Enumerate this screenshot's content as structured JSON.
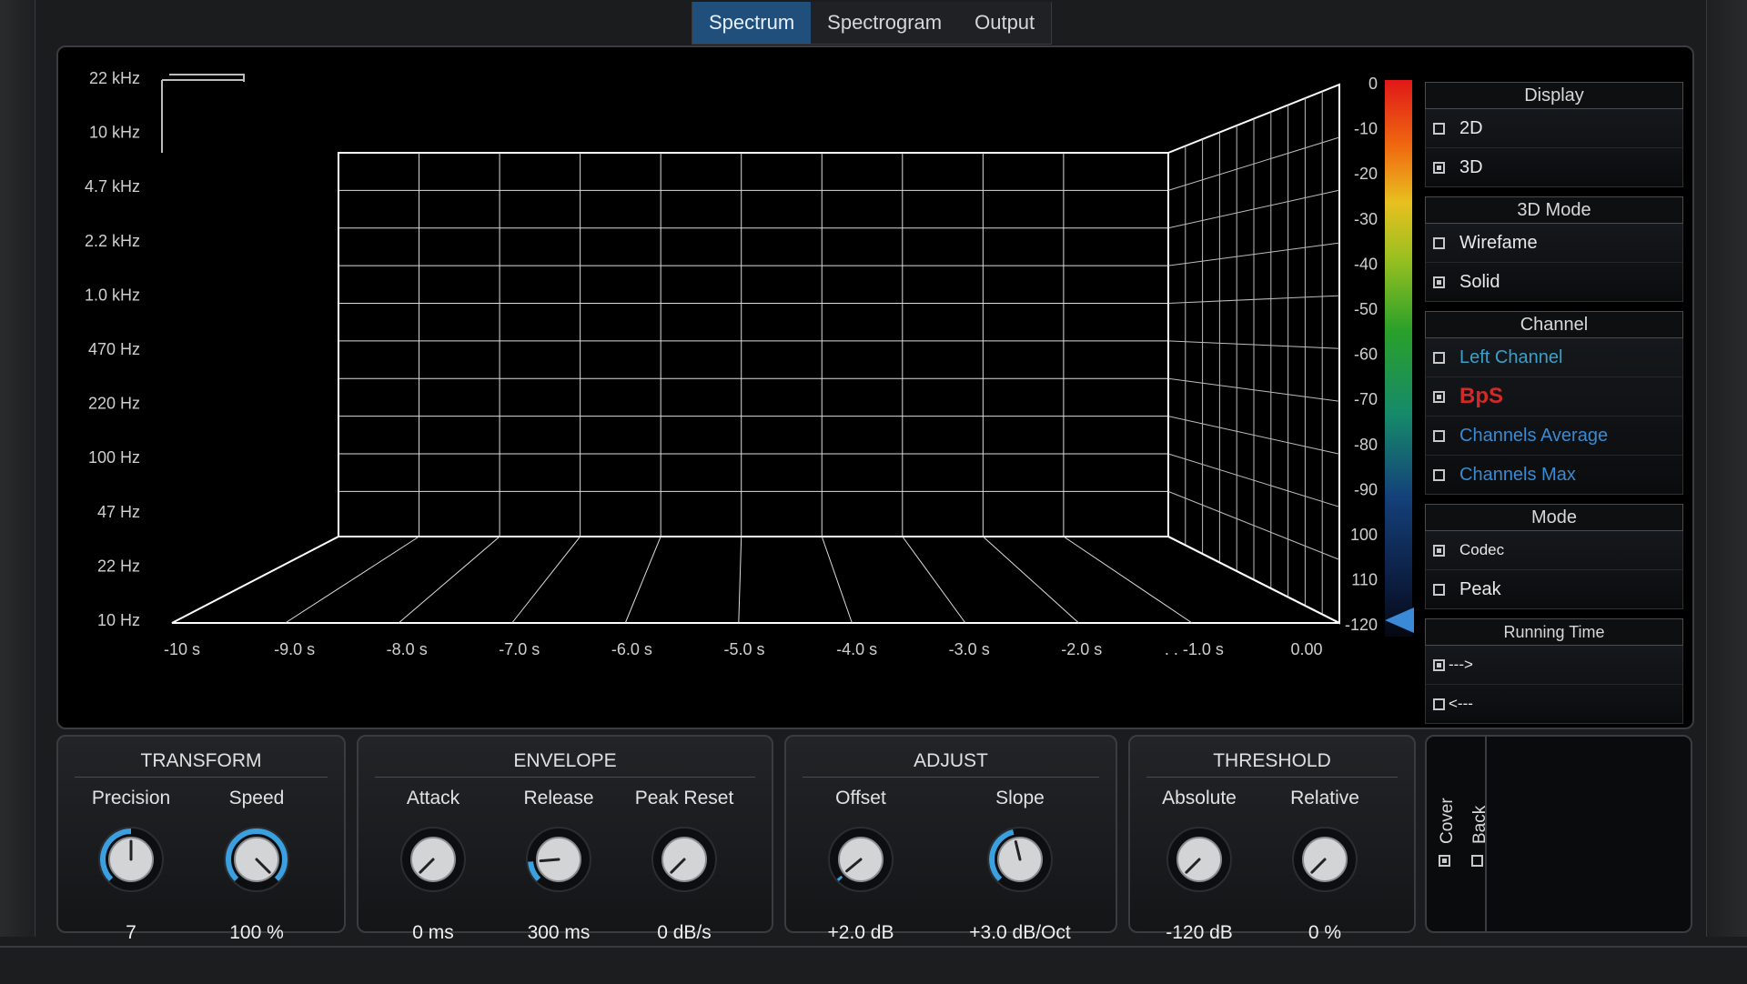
{
  "tabs": [
    {
      "label": "Spectrum",
      "active": true
    },
    {
      "label": "Spectrogram",
      "active": false
    },
    {
      "label": "Output",
      "active": false
    }
  ],
  "frequency_labels": [
    "22 kHz",
    "10 kHz",
    "4.7 kHz",
    "2.2 kHz",
    "1.0 kHz",
    "470 Hz",
    "220 Hz",
    "100 Hz",
    "47 Hz",
    "22 Hz",
    "10 Hz"
  ],
  "time_labels": [
    "-10 s",
    "-9.0 s",
    "-8.0 s",
    "-7.0 s",
    "-6.0 s",
    "-5.0 s",
    "-4.0 s",
    "-3.0 s",
    "-2.0 s",
    ". . -1.0 s",
    "0.00"
  ],
  "db_labels": [
    "0",
    "-10",
    "-20",
    "-30",
    "-40",
    "-50",
    "-60",
    "-70",
    "-80",
    "-90",
    "100",
    "110",
    "-120"
  ],
  "colors": {
    "accent": "#1f4f7a",
    "knob_ring": "#3aa0e0",
    "grid": "#ffffff"
  },
  "sidepanel": {
    "display": {
      "title": "Display",
      "options": [
        {
          "label": "2D",
          "checked": false
        },
        {
          "label": "3D",
          "checked": true
        }
      ]
    },
    "mode3d": {
      "title": "3D Mode",
      "options": [
        {
          "label": "Wirefame",
          "checked": false
        },
        {
          "label": "Solid",
          "checked": true
        }
      ]
    },
    "channel": {
      "title": "Channel",
      "options": [
        {
          "label": "Left Channel",
          "checked": false,
          "color": "#3aa0c8"
        },
        {
          "label": "BpS",
          "checked": true,
          "color": "#d22a2a"
        },
        {
          "label": "Channels Average",
          "checked": false,
          "color": "#3a8ad0"
        },
        {
          "label": "Channels Max",
          "checked": false,
          "color": "#3a8ad0"
        }
      ]
    },
    "mode": {
      "title": "Mode",
      "options": [
        {
          "label": "Codec",
          "checked": true
        },
        {
          "label": "Peak",
          "checked": false
        }
      ]
    },
    "running": {
      "title": "Running Time",
      "options": [
        {
          "label": "--->",
          "checked": true
        },
        {
          "label": "<---",
          "checked": false
        }
      ]
    }
  },
  "controls": {
    "transform": {
      "title": "TRANSFORM",
      "knobs": [
        {
          "label": "Precision",
          "value": "7",
          "level": 0.5
        },
        {
          "label": "Speed",
          "value": "100 %",
          "level": 1.0
        }
      ]
    },
    "envelope": {
      "title": "ENVELOPE",
      "knobs": [
        {
          "label": "Attack",
          "value": "0 ms",
          "level": 0
        },
        {
          "label": "Release",
          "value": "300 ms",
          "level": 0.15
        },
        {
          "label": "Peak Reset",
          "value": "0 dB/s",
          "level": 0
        }
      ]
    },
    "adjust": {
      "title": "ADJUST",
      "knobs": [
        {
          "label": "Offset",
          "value": "+2.0 dB",
          "level": 0.02
        },
        {
          "label": "Slope",
          "value": "+3.0 dB/Oct",
          "level": 0.45
        }
      ]
    },
    "threshold": {
      "title": "THRESHOLD",
      "knobs": [
        {
          "label": "Absolute",
          "value": "-120 dB",
          "level": 0
        },
        {
          "label": "Relative",
          "value": "0 %",
          "level": 0
        }
      ]
    }
  },
  "cover_back": {
    "cover_label": "Cover",
    "cover_checked": true,
    "back_label": "Back",
    "back_checked": false
  }
}
